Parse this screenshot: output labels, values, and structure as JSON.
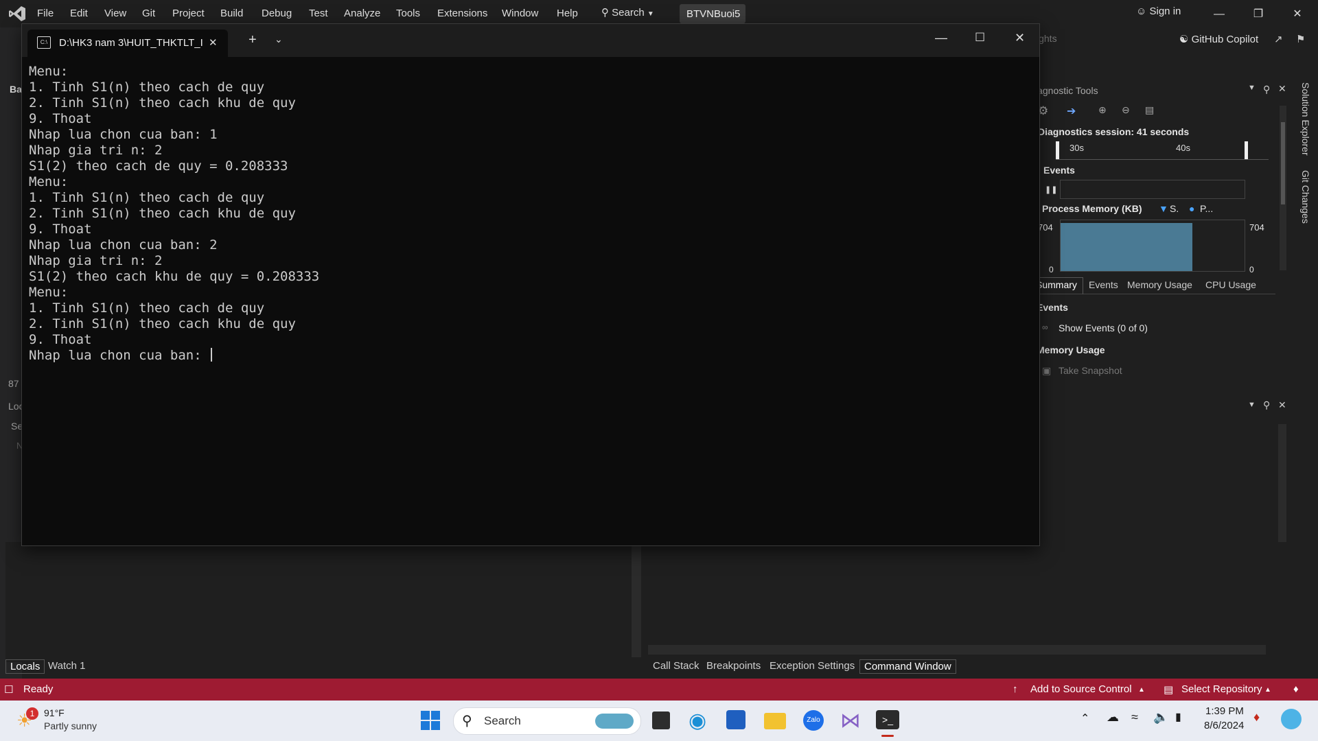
{
  "menubar": {
    "items": [
      "File",
      "Edit",
      "View",
      "Git",
      "Project",
      "Build",
      "Debug",
      "Test",
      "Analyze",
      "Tools",
      "Extensions",
      "Window",
      "Help"
    ],
    "search_label": "Search",
    "solution_name": "BTVNBuoi5",
    "sign_in": "Sign in",
    "copilot": "GitHub Copilot",
    "insights_partial": "ights"
  },
  "terminal": {
    "tab_title": "D:\\HK3 nam 3\\HUIT_THKTLT_I",
    "lines": [
      "Menu:",
      "1. Tinh S1(n) theo cach de quy",
      "2. Tinh S1(n) theo cach khu de quy",
      "9. Thoat",
      "Nhap lua chon cua ban: 1",
      "Nhap gia tri n: 2",
      "S1(2) theo cach de quy = 0.208333",
      "Menu:",
      "1. Tinh S1(n) theo cach de quy",
      "2. Tinh S1(n) theo cach khu de quy",
      "9. Thoat",
      "Nhap lua chon cua ban: 2",
      "Nhap gia tri n: 2",
      "S1(2) theo cach khu de quy = 0.208333",
      "Menu:",
      "1. Tinh S1(n) theo cach de quy",
      "2. Tinh S1(n) theo cach khu de quy",
      "9. Thoat",
      "Nhap lua chon cua ban: "
    ]
  },
  "diagnostics": {
    "title": "iagnostic Tools",
    "session": "Diagnostics session: 41 seconds",
    "tick_30": "30s",
    "tick_40": "40s",
    "events_label": "Events",
    "memory_label": "Process Memory (KB)",
    "legend_s": "S.",
    "legend_p": "P...",
    "mem_max_left": "704",
    "mem_max_right": "704",
    "mem_min_left": "0",
    "mem_min_right": "0",
    "tabs": [
      "Summary",
      "Events",
      "Memory Usage",
      "CPU Usage"
    ],
    "section_events": "Events",
    "show_events": "Show Events (0 of 0)",
    "section_memory": "Memory Usage",
    "take_snapshot": "Take Snapshot"
  },
  "side_tabs": {
    "solution_explorer": "Solution Explorer",
    "git_changes": "Git Changes"
  },
  "left_fragments": {
    "ba": "Ba",
    "num": "87",
    "lo": "Loc",
    "se": "Se",
    "n": "N"
  },
  "bottom_left_tabs": [
    "Locals",
    "Watch 1"
  ],
  "bottom_right_tabs": [
    "Call Stack",
    "Breakpoints",
    "Exception Settings",
    "Command Window"
  ],
  "statusbar": {
    "ready": "Ready",
    "add_source": "Add to Source Control",
    "select_repo": "Select Repository"
  },
  "taskbar": {
    "weather_temp": "91°F",
    "weather_desc": "Partly sunny",
    "weather_badge": "1",
    "search_label": "Search",
    "time": "1:39 PM",
    "date": "8/6/2024"
  },
  "colors": {
    "statusbar": "#9e1b32",
    "terminal_bg": "#0c0c0c",
    "vs_bg": "#1f1f1f",
    "memory_bar": "#4a7a94"
  }
}
